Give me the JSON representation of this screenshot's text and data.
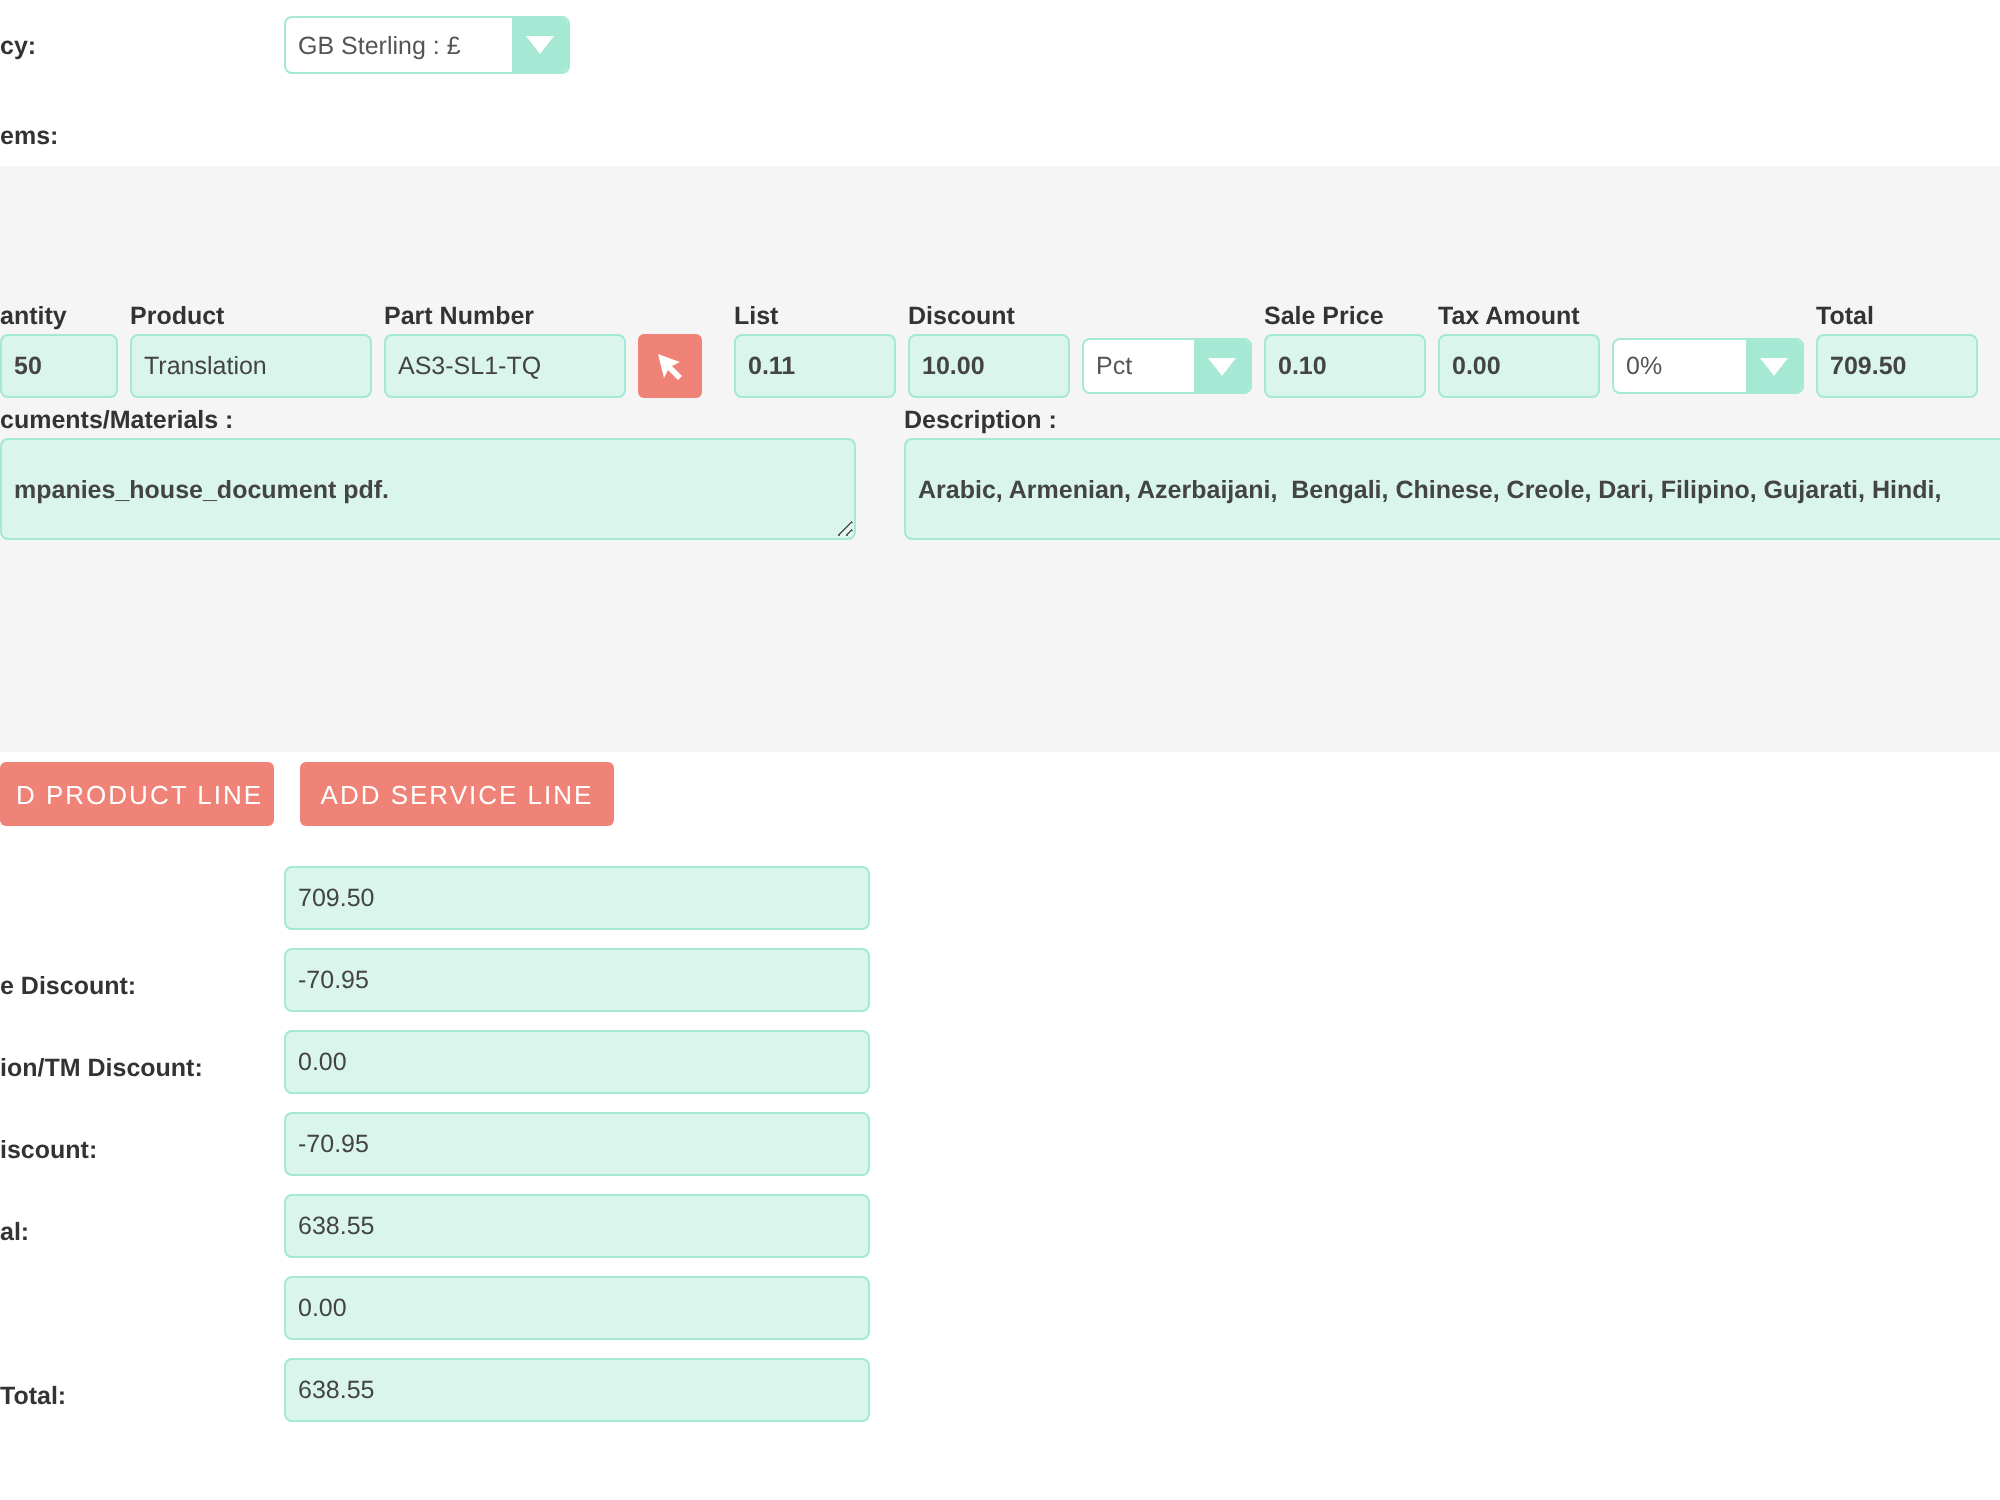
{
  "currency": {
    "label": "cy:",
    "value": "GB Sterling : £"
  },
  "line_items": {
    "label": "ems:",
    "cells": [
      {
        "kind": "input",
        "label": "antity",
        "value": "50"
      },
      {
        "kind": "input",
        "label": "Product",
        "value": "Translation"
      },
      {
        "kind": "input",
        "label": "Part Number",
        "value": "AS3-SL1-TQ"
      },
      {
        "kind": "picker"
      },
      {
        "kind": "input",
        "label": "List",
        "value": "0.11"
      },
      {
        "kind": "input",
        "label": "Discount",
        "value": "10.00"
      },
      {
        "kind": "select",
        "value": "Pct"
      },
      {
        "kind": "input",
        "label": "Sale Price",
        "value": "0.10"
      },
      {
        "kind": "input",
        "label": "Tax Amount",
        "value": "0.00"
      },
      {
        "kind": "select",
        "value": "0%"
      },
      {
        "kind": "input",
        "label": "Total",
        "value": "709.50"
      }
    ],
    "documents": {
      "label": "cuments/Materials :",
      "value": "mpanies_house_document pdf."
    },
    "description": {
      "label": "Description :",
      "value": "Arabic, Armenian, Azerbaijani,  Bengali, Chinese, Creole, Dari, Filipino, Gujarati, Hindi,"
    }
  },
  "buttons": [
    "D PRODUCT LINE",
    "ADD SERVICE LINE"
  ],
  "totals": [
    {
      "value": "709.50"
    },
    {
      "label": "e Discount:",
      "value": "-70.95"
    },
    {
      "label": "ion/TM Discount:",
      "value": "0.00"
    },
    {
      "label": "iscount:",
      "value": "-70.95"
    },
    {
      "label": "al:",
      "value": "638.55"
    },
    {
      "value": "0.00"
    },
    {
      "label": "Total:",
      "value": "638.55"
    }
  ]
}
